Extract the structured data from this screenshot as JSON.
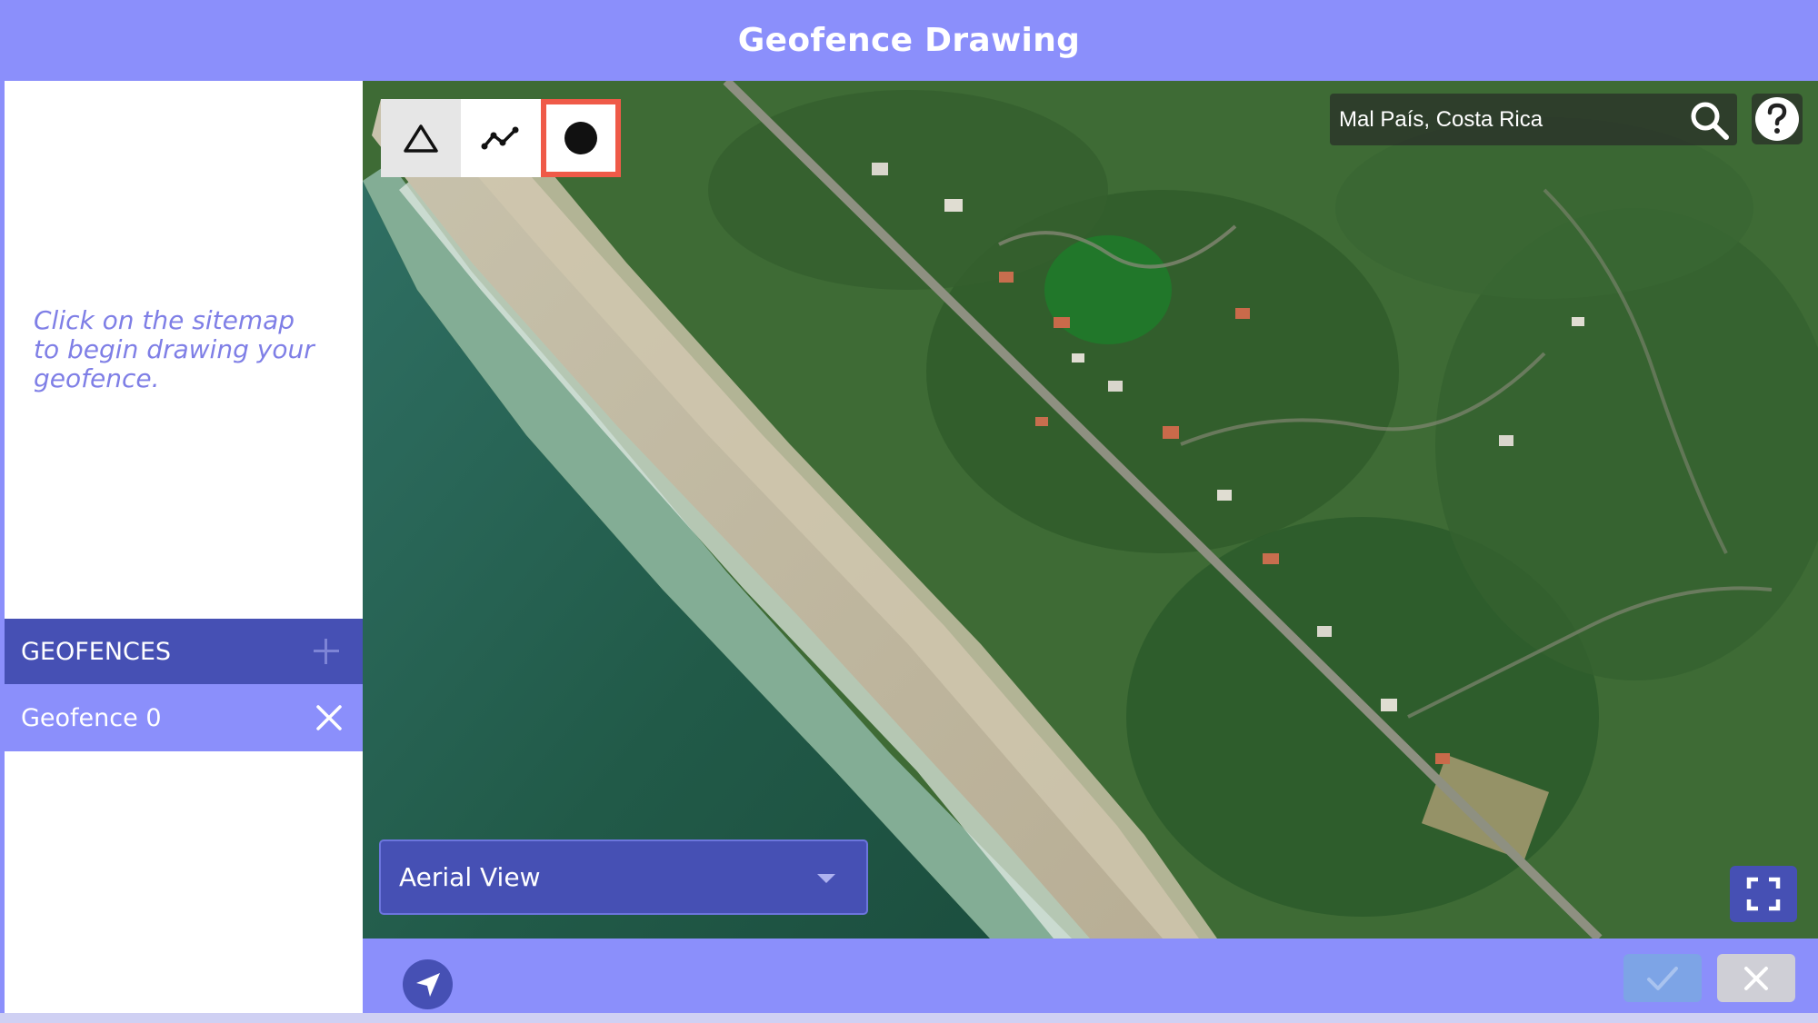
{
  "header": {
    "title": "Geofence Drawing"
  },
  "sidebar": {
    "hint": "Click on the sitemap to begin drawing your geofence.",
    "geofences_header": "GEOFENCES",
    "geofences": [
      {
        "label": "Geofence 0"
      }
    ]
  },
  "map": {
    "toolbar": {
      "tools": [
        {
          "name": "polygon",
          "icon": "triangle-icon"
        },
        {
          "name": "polyline",
          "icon": "polyline-icon"
        },
        {
          "name": "circle",
          "icon": "circle-icon",
          "selected": true
        }
      ]
    },
    "search": {
      "value": "Mal País, Costa Rica"
    },
    "layer_select": {
      "selected": "Aerial View"
    }
  },
  "colors": {
    "accent": "#8b8ffb",
    "dark_accent": "#4650b4",
    "selected_tool_border": "#ef5a48",
    "confirm": "#7da4e6",
    "cancel": "#cfcfd6"
  }
}
